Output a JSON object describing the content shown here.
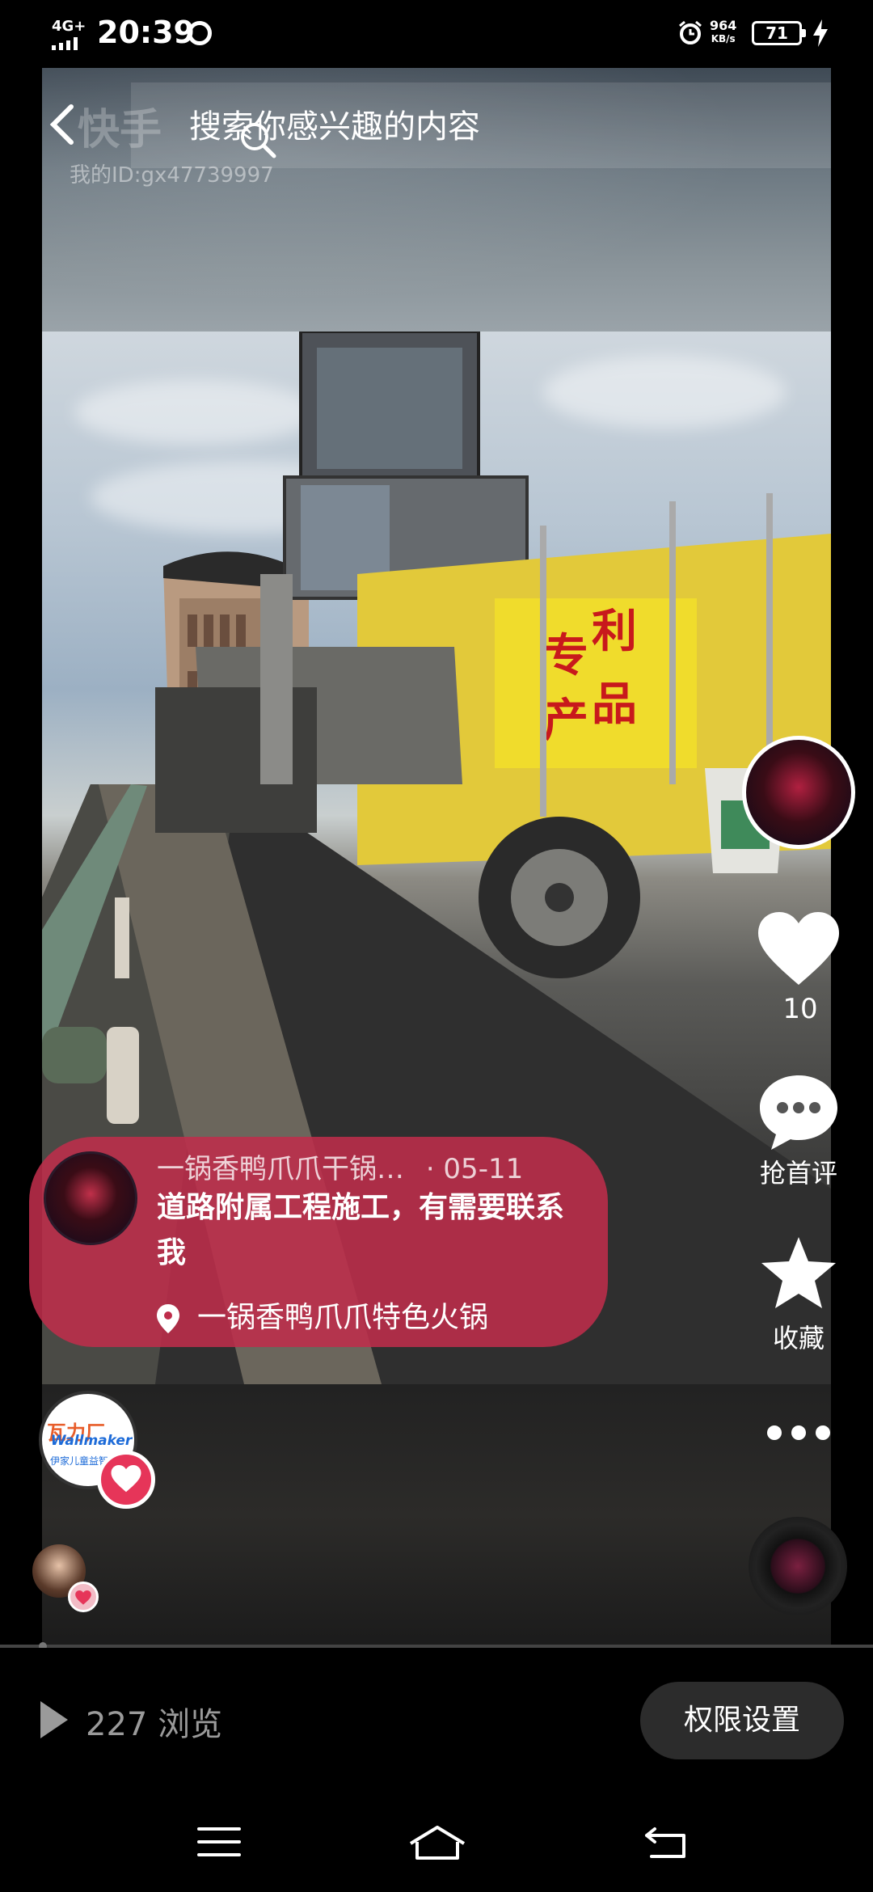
{
  "status_bar": {
    "network": "4G+",
    "time": "20:39",
    "speed_value": "964",
    "speed_unit": "KB/s",
    "battery": "71"
  },
  "header": {
    "search_placeholder": "搜索你感兴趣的内容",
    "brand_ghost": "快手",
    "my_id": "我的ID:gx47739997"
  },
  "post": {
    "author": "一锅香鸭爪爪干锅…",
    "date": "· 05-11",
    "description": "道路附属工程施工，有需要联系我",
    "location": "一锅香鸭爪爪特色火锅",
    "truck_sign": [
      "专",
      "利",
      "产",
      "品"
    ]
  },
  "actions": {
    "like_count": "10",
    "comment_label": "抢首评",
    "collect_label": "收藏"
  },
  "sponsor": {
    "logo_top": "瓦力厂",
    "logo_name": "Wallmaker",
    "logo_sub": "伊家儿童益智"
  },
  "footer": {
    "views": "227 浏览",
    "permission_button": "权限设置"
  },
  "colors": {
    "card": "#be2d4b",
    "heart_badge": "#e63559"
  }
}
